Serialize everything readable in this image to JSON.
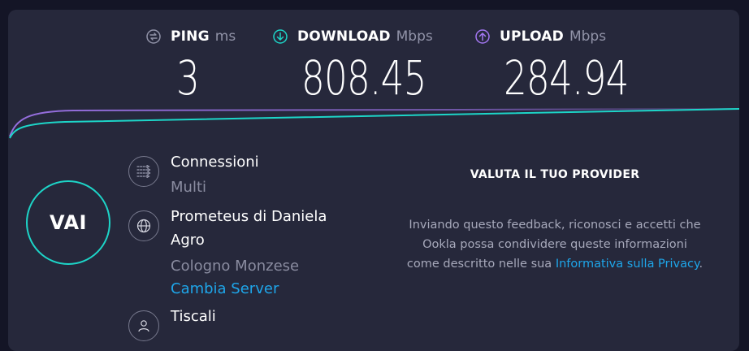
{
  "metrics": {
    "ping": {
      "label": "PING",
      "unit": "ms",
      "value": "3"
    },
    "download": {
      "label": "DOWNLOAD",
      "unit": "Mbps",
      "value": "808.45"
    },
    "upload": {
      "label": "UPLOAD",
      "unit": "Mbps",
      "value": "284.94"
    }
  },
  "go_button": {
    "label": "VAI"
  },
  "connections": {
    "title": "Connessioni",
    "value": "Multi"
  },
  "server": {
    "title_line1": "Prometeus di Daniela",
    "title_line2": "Agro",
    "location": "Cologno Monzese",
    "change_link": "Cambia Server"
  },
  "isp": {
    "name": "Tiscali"
  },
  "provider": {
    "title": "VALUTA IL TUO PROVIDER",
    "text_line1": "Inviando questo feedback, riconosci e accetti che",
    "text_line2": "Ookla possa condividere queste informazioni",
    "text_line3_prefix": "come descritto nelle sua ",
    "privacy_link": "Informativa sulla Privacy",
    "text_line3_suffix": "."
  },
  "colors": {
    "download": "#1dd5c8",
    "upload": "#a377f2",
    "link": "#1ea6ea",
    "background": "#26283b"
  },
  "icons": [
    "ping-icon",
    "download-icon",
    "upload-icon",
    "connections-icon",
    "globe-icon",
    "user-icon"
  ]
}
